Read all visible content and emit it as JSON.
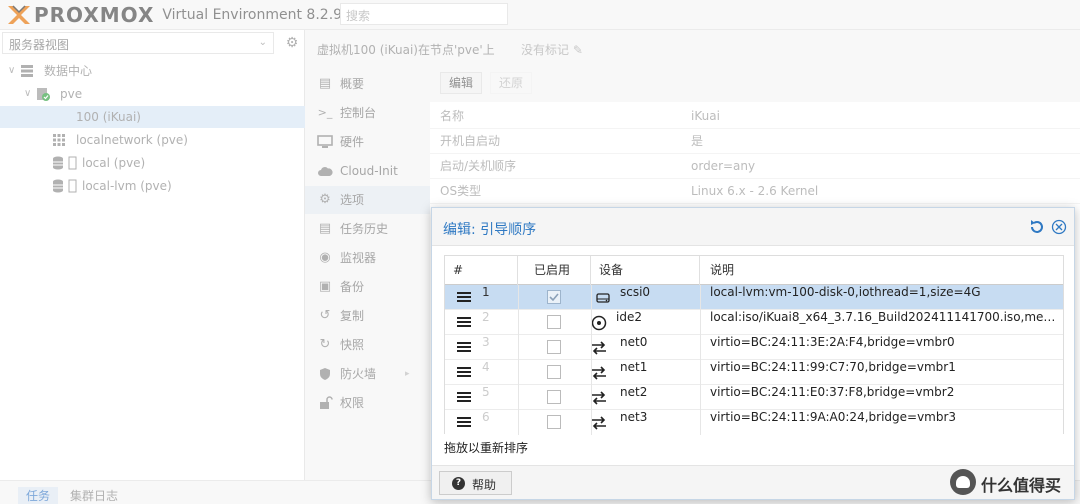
{
  "app": {
    "logo_text": "PROXMOX",
    "subtitle": "Virtual Environment 8.2.9",
    "search_placeholder": "搜索"
  },
  "tree": {
    "view_select": "服务器视图",
    "datacenter": "数据中心",
    "node": "pve",
    "vm": "100 (iKuai)",
    "localnetwork": "localnetwork (pve)",
    "local": "local (pve)",
    "local_lvm": "local-lvm (pve)"
  },
  "header": {
    "vm_title": "虚拟机100 (iKuai)在节点'pve'上",
    "tags": "没有标记"
  },
  "menu": [
    {
      "label": "概要",
      "icon": "summary-icon"
    },
    {
      "label": "控制台",
      "icon": "terminal-icon"
    },
    {
      "label": "硬件",
      "icon": "monitor-icon"
    },
    {
      "label": "Cloud-Init",
      "icon": "cloud-icon"
    },
    {
      "label": "选项",
      "icon": "gear-icon"
    },
    {
      "label": "任务历史",
      "icon": "list-icon"
    },
    {
      "label": "监视器",
      "icon": "eye-icon"
    },
    {
      "label": "备份",
      "icon": "floppy-icon"
    },
    {
      "label": "复制",
      "icon": "retweet-icon"
    },
    {
      "label": "快照",
      "icon": "history-icon"
    },
    {
      "label": "防火墙",
      "icon": "shield-icon"
    },
    {
      "label": "权限",
      "icon": "unlock-icon"
    }
  ],
  "toolbar": {
    "edit": "编辑",
    "revert": "还原"
  },
  "properties": [
    {
      "key": "名称",
      "value": "iKuai"
    },
    {
      "key": "开机自启动",
      "value": "是"
    },
    {
      "key": "启动/关机顺序",
      "value": "order=any"
    },
    {
      "key": "OS类型",
      "value": "Linux 6.x - 2.6 Kernel"
    }
  ],
  "bottom_tabs": {
    "tasks": "任务",
    "cluster_log": "集群日志"
  },
  "dialog": {
    "title": "编辑: 引导顺序",
    "columns": {
      "num": "#",
      "enabled": "已启用",
      "device": "设备",
      "desc": "说明"
    },
    "rows": [
      {
        "num": "1",
        "enabled": true,
        "device": "scsi0",
        "type": "disk",
        "desc": "local-lvm:vm-100-disk-0,iothread=1,size=4G"
      },
      {
        "num": "2",
        "enabled": false,
        "device": "ide2",
        "type": "cdrom",
        "desc": "local:iso/iKuai8_x64_3.7.16_Build202411141700.iso,med..."
      },
      {
        "num": "3",
        "enabled": false,
        "device": "net0",
        "type": "net",
        "desc": "virtio=BC:24:11:3E:2A:F4,bridge=vmbr0"
      },
      {
        "num": "4",
        "enabled": false,
        "device": "net1",
        "type": "net",
        "desc": "virtio=BC:24:11:99:C7:70,bridge=vmbr1"
      },
      {
        "num": "5",
        "enabled": false,
        "device": "net2",
        "type": "net",
        "desc": "virtio=BC:24:11:E0:37:F8,bridge=vmbr2"
      },
      {
        "num": "6",
        "enabled": false,
        "device": "net3",
        "type": "net",
        "desc": "virtio=BC:24:11:9A:A0:24,bridge=vmbr3"
      }
    ],
    "hint": "拖放以重新排序",
    "help": "帮助"
  },
  "watermark": {
    "text": "什么值得买"
  },
  "colors": {
    "accent": "#2f79c3",
    "selected_row": "#c7dcf2"
  }
}
